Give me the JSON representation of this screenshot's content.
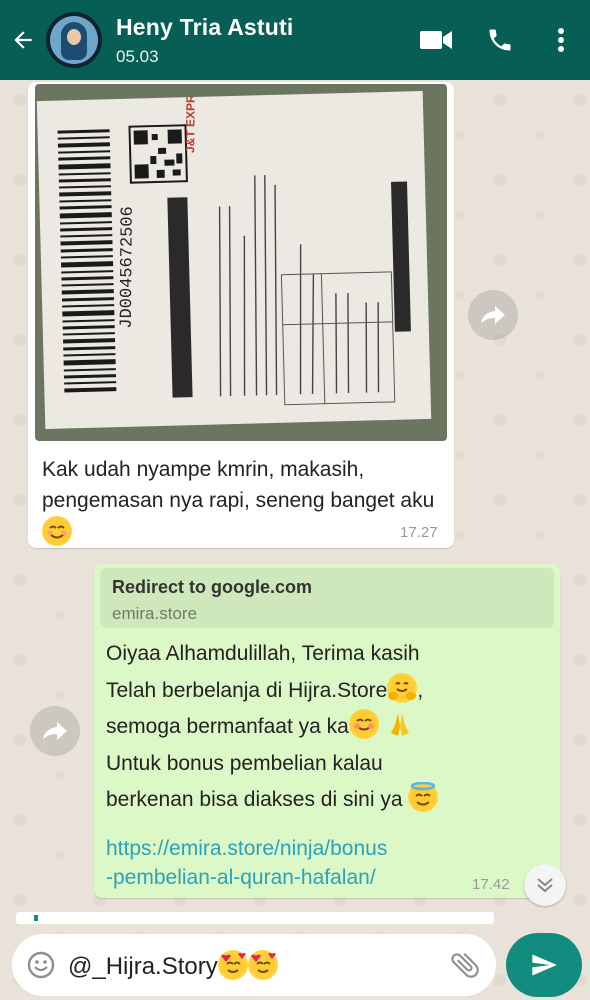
{
  "header": {
    "contact_name": "Heny Tria Astuti",
    "last_seen": "05.03"
  },
  "incoming": {
    "image_alt": "photo of J&T Express shipping label",
    "label_tracking": "JD0045672506",
    "label_brand": "J&T EXPRESS",
    "text": "Kak udah nyampe kmrin, makasih, pengemasan nya rapi, seneng banget aku",
    "time": "17.27"
  },
  "outgoing": {
    "preview_title": "Redirect to google.com",
    "preview_domain": "emira.store",
    "line1": "Oiyaa Alhamdulillah, Terima kasih",
    "line2": "Telah berbelanja di Hijra.Store",
    "line2_end": ",",
    "line3": "semoga bermanfaat ya ka",
    "line4": "Untuk bonus pembelian kalau",
    "line5": "berkenan bisa diakses di sini ya",
    "link_line1": "https://emira.store/ninja/bonus",
    "link_line2": "-pembelian-al-quran-hafalan/",
    "time": "17.42"
  },
  "composer": {
    "text": "@_Hijra.Story"
  },
  "colors": {
    "header_bg": "#075e54",
    "outgoing_bg": "#dcf8c6",
    "link": "#2aa2b8",
    "send_button": "#128c7e"
  },
  "icons": [
    "back-arrow-icon",
    "video-call-icon",
    "phone-icon",
    "more-vert-icon",
    "forward-icon",
    "double-chevron-down-icon",
    "emoji-icon",
    "attach-icon",
    "send-icon"
  ]
}
